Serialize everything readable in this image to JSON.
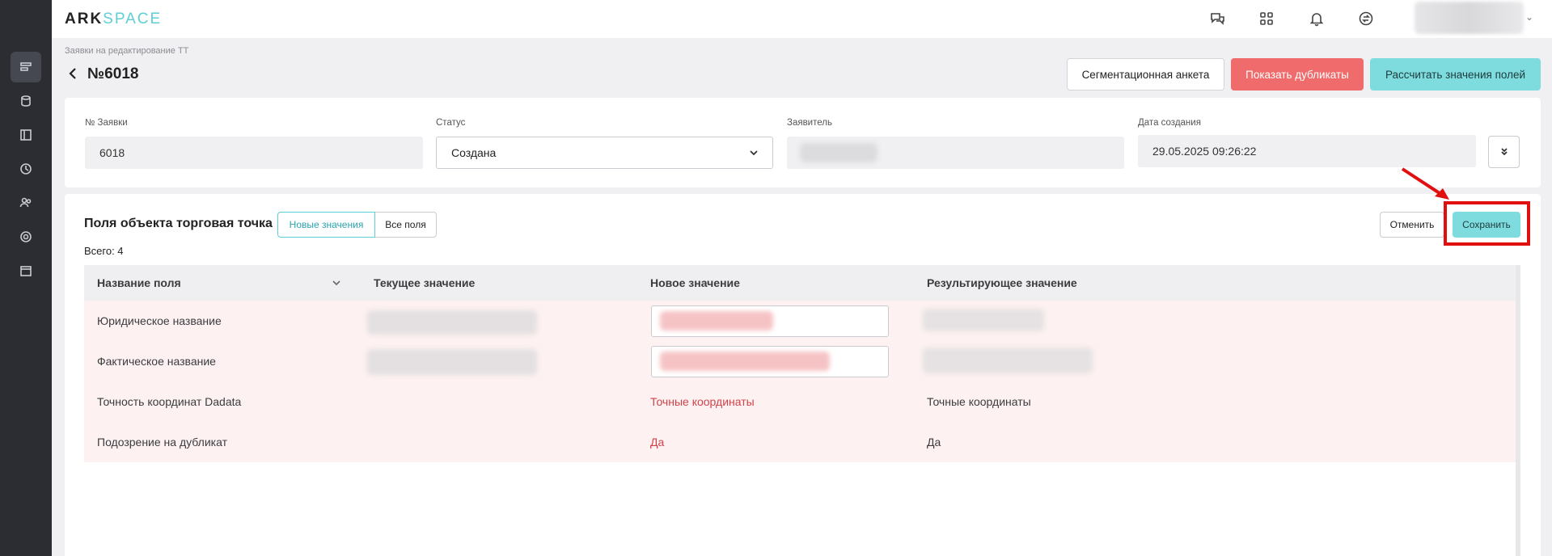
{
  "app": {
    "logo_ark": "ARK",
    "logo_space": "SPACE"
  },
  "sidebar": {
    "items": [
      {
        "icon": "requests-icon",
        "active": true
      },
      {
        "icon": "database-icon",
        "active": false
      },
      {
        "icon": "layout-icon",
        "active": false
      },
      {
        "icon": "history-icon",
        "active": false
      },
      {
        "icon": "users-icon",
        "active": false
      },
      {
        "icon": "settings-icon",
        "active": false
      },
      {
        "icon": "calendar-icon",
        "active": false
      }
    ]
  },
  "topbar": {
    "icons": [
      "chat-question-icon",
      "apps-grid-icon",
      "bell-icon",
      "sync-icon"
    ]
  },
  "header": {
    "breadcrumb": "Заявки на редактирование ТТ",
    "title": "№6018",
    "buttons": {
      "segmentation": "Сегментационная анкета",
      "duplicates": "Показать дубликаты",
      "calculate": "Рассчитать значения полей"
    }
  },
  "details": {
    "request_no_label": "№ Заявки",
    "request_no_value": "6018",
    "status_label": "Статус",
    "status_value": "Создана",
    "applicant_label": "Заявитель",
    "created_label": "Дата создания",
    "created_value": "29.05.2025 09:26:22"
  },
  "section": {
    "title": "Поля объекта торговая точка",
    "toggle_new": "Новые значения",
    "toggle_all": "Все поля",
    "total": "Всего: 4",
    "cancel": "Отменить",
    "save": "Сохранить"
  },
  "table": {
    "columns": [
      "Название поля",
      "Текущее значение",
      "Новое значение",
      "Результирующее значение"
    ],
    "rows": [
      {
        "name": "Юридическое название",
        "current": "",
        "new": "",
        "result": ""
      },
      {
        "name": "Фактическое название",
        "current": "",
        "new": "",
        "result": ""
      },
      {
        "name": "Точность координат Dadata",
        "current": "",
        "new": "Точные координаты",
        "result": "Точные координаты"
      },
      {
        "name": "Подозрение на дубликат",
        "current": "",
        "new": "Да",
        "result": "Да"
      }
    ]
  },
  "colors": {
    "accent": "#7fdcde",
    "danger": "#f06b6b",
    "sidebar_bg": "#2b2d33",
    "row_highlight": "#fdf1f1",
    "annotation": "#e01010"
  }
}
